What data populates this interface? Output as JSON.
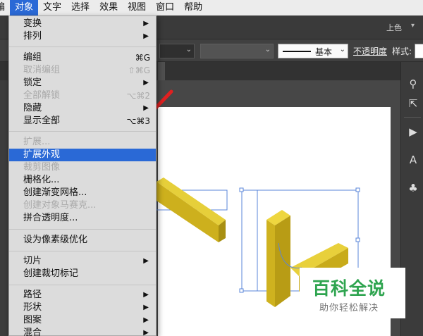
{
  "menubar": {
    "items": [
      {
        "label": "编",
        "active": false
      },
      {
        "label": "对象",
        "active": true
      },
      {
        "label": "文字",
        "active": false
      },
      {
        "label": "选择",
        "active": false
      },
      {
        "label": "效果",
        "active": false
      },
      {
        "label": "视图",
        "active": false
      },
      {
        "label": "窗口",
        "active": false
      },
      {
        "label": "帮助",
        "active": false
      }
    ]
  },
  "appbar": {
    "workspace_label": "上色"
  },
  "control_bar": {
    "stroke_profile_label": "基本",
    "opacity_label": "不透明度",
    "style_label": "样式:"
  },
  "object_menu": {
    "items": [
      {
        "label": "变换",
        "submenu": true
      },
      {
        "label": "排列",
        "submenu": true
      },
      {
        "label": "编组",
        "shortcut": "⌘G"
      },
      {
        "label": "取消编组",
        "shortcut": "⇧⌘G",
        "disabled": true
      },
      {
        "label": "锁定",
        "submenu": true
      },
      {
        "label": "全部解锁",
        "shortcut": "⌥⌘2",
        "disabled": true
      },
      {
        "label": "隐藏",
        "submenu": true
      },
      {
        "label": "显示全部",
        "shortcut": "⌥⌘3"
      },
      {
        "label": "扩展...",
        "disabled": true
      },
      {
        "label": "扩展外观",
        "highlighted": true
      },
      {
        "label": "裁剪图像",
        "disabled": true
      },
      {
        "label": "栅格化..."
      },
      {
        "label": "创建渐变网格..."
      },
      {
        "label": "创建对象马赛克...",
        "disabled": true
      },
      {
        "label": "拼合透明度..."
      },
      {
        "label": "设为像素级优化"
      },
      {
        "label": "切片",
        "submenu": true
      },
      {
        "label": "创建裁切标记"
      },
      {
        "label": "路径",
        "submenu": true
      },
      {
        "label": "形状",
        "submenu": true
      },
      {
        "label": "图案",
        "submenu": true
      },
      {
        "label": "混合",
        "submenu": true
      }
    ]
  },
  "watermark": {
    "title": "百科全说",
    "subtitle": "助你轻松解决"
  },
  "colors": {
    "menu_highlight": "#2a69d6",
    "arrow": "#e02020",
    "shape_yellow": "#d4b81f",
    "selection_blue": "#5a86d8",
    "watermark_green": "#2ea44f"
  }
}
